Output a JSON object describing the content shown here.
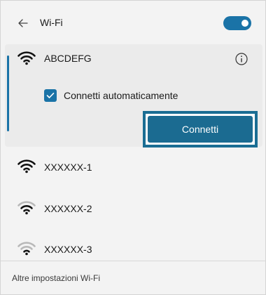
{
  "header": {
    "back_icon": "arrow-left-icon",
    "title": "Wi-Fi",
    "wifi_enabled": true
  },
  "selected_network": {
    "name": "ABCDEFG",
    "info_icon": "info-icon",
    "auto_connect_label": "Connetti automaticamente",
    "auto_connect_checked": true,
    "connect_label": "Connetti"
  },
  "networks": [
    {
      "name": "XXXXXX-1",
      "signal_bars": 4
    },
    {
      "name": "XXXXXX-2",
      "signal_bars": 3
    },
    {
      "name": "XXXXXX-3",
      "signal_bars": 2
    }
  ],
  "footer": {
    "more_settings_label": "Altre impostazioni Wi-Fi"
  },
  "colors": {
    "accent": "#1a73a7",
    "panel_bg": "#f3f3f3",
    "selected_bg": "#ebebeb"
  }
}
